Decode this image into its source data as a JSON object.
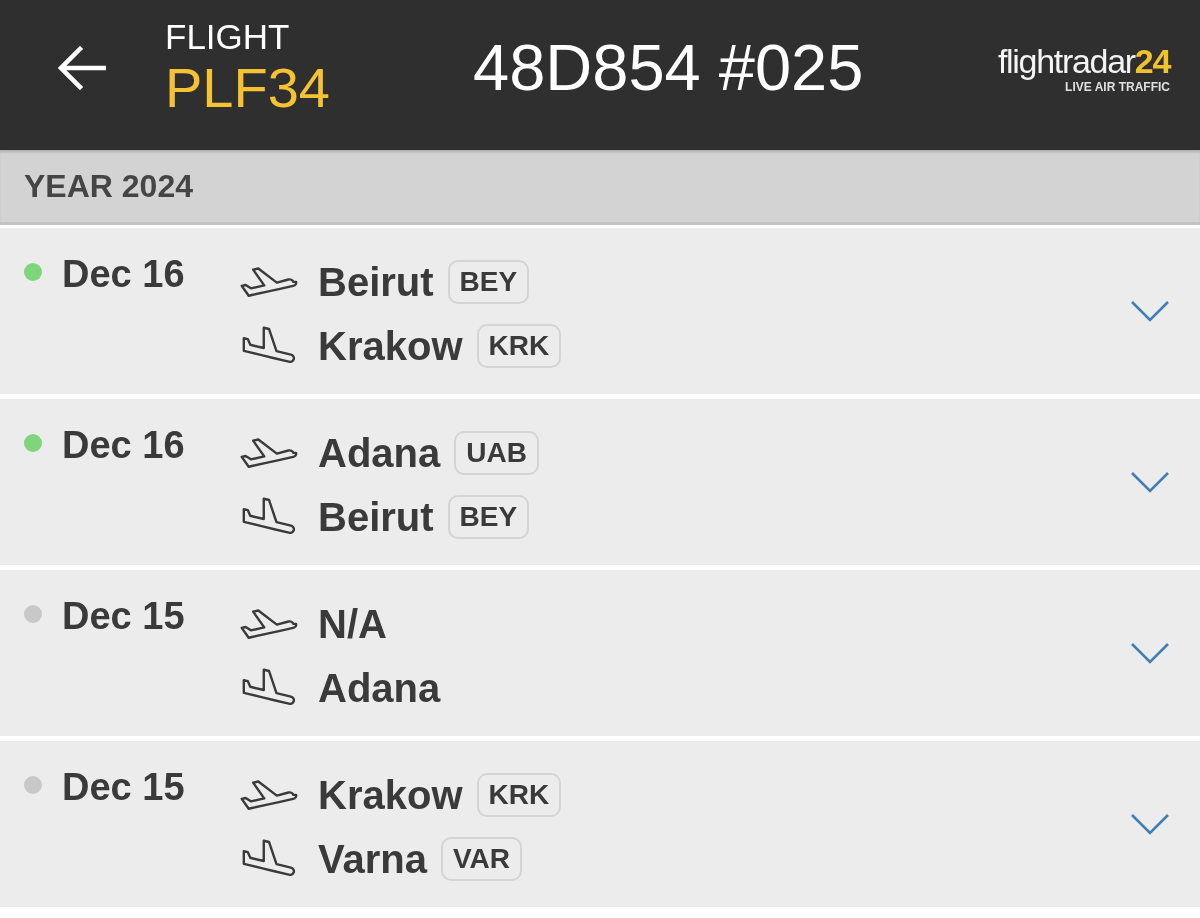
{
  "app_bar": {
    "label": "FLIGHT",
    "flight": "PLF34",
    "title": "48D854 #025",
    "logo": {
      "wordmark": "flightradar",
      "wordmark_accent": "24",
      "tagline": "LIVE AIR TRAFFIC"
    }
  },
  "section": {
    "title": "YEAR 2024"
  },
  "flights": [
    {
      "date": "Dec 16",
      "color": "#80d47c",
      "departure": {
        "city": "Beirut",
        "code": "BEY"
      },
      "arrival": {
        "city": "Krakow",
        "code": "KRK"
      },
      "expanded": false
    },
    {
      "date": "Dec 16",
      "color": "#80d47c",
      "departure": {
        "city": "Adana",
        "code": "UAB"
      },
      "arrival": {
        "city": "Beirut",
        "code": "BEY"
      },
      "expanded": false
    },
    {
      "date": "Dec 15",
      "color": "#c8c8c8",
      "departure": {
        "city": "N/A"
      },
      "arrival": {
        "city": "Adana"
      },
      "expanded": false
    },
    {
      "date": "Dec 15",
      "color": "#c8c8c8",
      "departure": {
        "city": "Krakow",
        "code": "KRK"
      },
      "arrival": {
        "city": "Varna",
        "code": "VAR"
      },
      "expanded": false
    }
  ]
}
